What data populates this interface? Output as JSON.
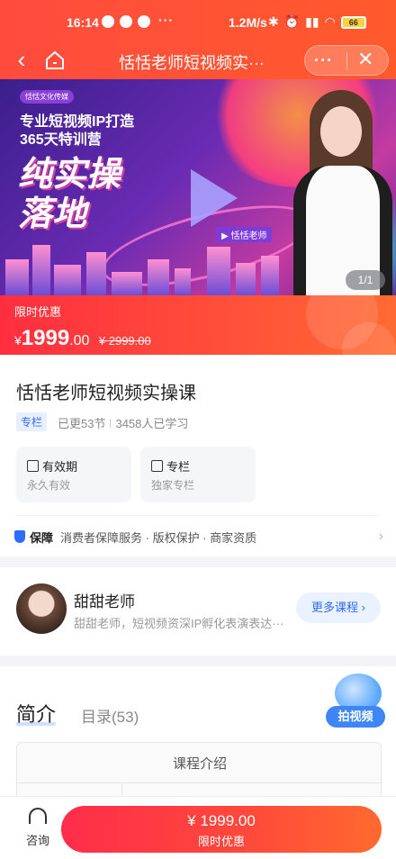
{
  "status_bar": {
    "time": "16:14",
    "more": "···",
    "speed": "1.2M/s",
    "battery": "66"
  },
  "nav": {
    "back_icon": "chevron-left-icon",
    "home_icon": "home-icon",
    "title": "恬恬老师短视频实···",
    "menu_icon": "more-dots-icon",
    "more": "···",
    "close_icon": "close-icon",
    "close": "✕"
  },
  "banner": {
    "brand_tag": "恬恬文化传媒",
    "headline_line1": "专业短视频IP打造",
    "headline_line2": "365天特训营",
    "big_line1": "纯实操",
    "big_line2": "落地",
    "teacher_tag": "▶ 恬恬老师",
    "pager": "1/1"
  },
  "price_band": {
    "promo_label": "限时优惠",
    "currency": "¥",
    "price_int": "1999",
    "price_dec": ".00",
    "original_price": "¥ 2999.00"
  },
  "course": {
    "title": "恬恬老师短视频实操课",
    "tag": "专栏",
    "updated": "已更53节",
    "learners": "3458人已学习",
    "validity": {
      "icon": "calendar-icon",
      "title": "有效期",
      "value": "永久有效"
    },
    "column": {
      "icon": "bookmark-icon",
      "title": "专栏",
      "value": "独家专栏"
    },
    "guarantee": {
      "icon": "shield-icon",
      "label": "保障",
      "items": "消费者保障服务 · 版权保护 · 商家资质",
      "chevron": "›"
    }
  },
  "teacher": {
    "name": "甜甜老师",
    "desc": "甜甜老师，短视频资深IP孵化表演表达···",
    "more_button": "更多课程 ›"
  },
  "intro": {
    "tab_active": "简介",
    "tab_catalog": "目录(53)",
    "float_button": "拍视频",
    "float_icon": "camera-icon",
    "table_header": "课程介绍"
  },
  "bottom_bar": {
    "consult_icon": "headset-icon",
    "consult_label": "咨询",
    "buy_price": "¥ 1999.00",
    "buy_label": "限时优惠"
  },
  "colors": {
    "accent_red": "#ff4b3e",
    "link_blue": "#2f6bff"
  }
}
